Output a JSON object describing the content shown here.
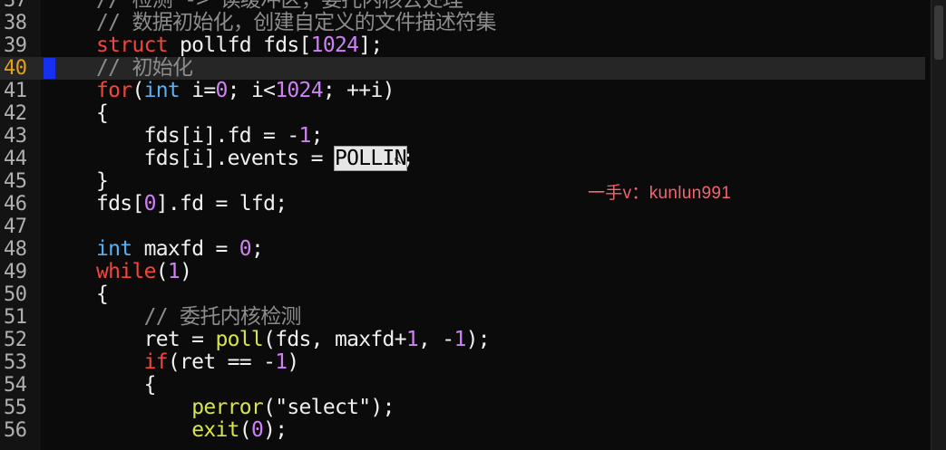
{
  "editor": {
    "current_line": "40",
    "watermark": "一手v：kunlun991",
    "colors": {
      "background": "#0b0b0b",
      "comment": "#8c8c8c",
      "keyword": "#f5453b",
      "type": "#5ab0f5",
      "number": "#d080f5",
      "function": "#d7e548",
      "current_line_number": "#e3a21a",
      "breakpoint_marker": "#1530f0"
    },
    "lines": [
      {
        "num": "37",
        "tokens": [
          {
            "text": "// 检测 -> 读缓冲区，委托内核去处理",
            "type": "comment"
          }
        ]
      },
      {
        "num": "38",
        "tokens": [
          {
            "text": "// 数据初始化，创建自定义的文件描述符集",
            "type": "comment"
          }
        ]
      },
      {
        "num": "39",
        "tokens": [
          {
            "text": "struct",
            "type": "keyword"
          },
          {
            "text": " pollfd fds[",
            "type": "plain"
          },
          {
            "text": "1024",
            "type": "number"
          },
          {
            "text": "];",
            "type": "plain"
          }
        ]
      },
      {
        "num": "40",
        "tokens": [
          {
            "text": "// 初始化",
            "type": "comment"
          }
        ]
      },
      {
        "num": "41",
        "tokens": [
          {
            "text": "for",
            "type": "keyword"
          },
          {
            "text": "(",
            "type": "plain"
          },
          {
            "text": "int",
            "type": "type"
          },
          {
            "text": " i=",
            "type": "plain"
          },
          {
            "text": "0",
            "type": "number"
          },
          {
            "text": "; i<",
            "type": "plain"
          },
          {
            "text": "1024",
            "type": "number"
          },
          {
            "text": "; ++i)",
            "type": "plain"
          }
        ]
      },
      {
        "num": "42",
        "tokens": [
          {
            "text": "{",
            "type": "plain"
          }
        ]
      },
      {
        "num": "43",
        "tokens": [
          {
            "text": "    fds[i].fd = -",
            "type": "plain"
          },
          {
            "text": "1",
            "type": "number"
          },
          {
            "text": ";",
            "type": "plain"
          }
        ]
      },
      {
        "num": "44",
        "tokens": [
          {
            "text": "    fds[i].events = ",
            "type": "plain"
          },
          {
            "text": "POLLIN",
            "type": "highlight"
          },
          {
            "text": ";",
            "type": "plain"
          }
        ]
      },
      {
        "num": "45",
        "tokens": [
          {
            "text": "}",
            "type": "plain"
          }
        ]
      },
      {
        "num": "46",
        "tokens": [
          {
            "text": "fds[",
            "type": "plain"
          },
          {
            "text": "0",
            "type": "number"
          },
          {
            "text": "].fd = lfd;",
            "type": "plain"
          }
        ]
      },
      {
        "num": "47",
        "tokens": []
      },
      {
        "num": "48",
        "tokens": [
          {
            "text": "int",
            "type": "type"
          },
          {
            "text": " maxfd = ",
            "type": "plain"
          },
          {
            "text": "0",
            "type": "number"
          },
          {
            "text": ";",
            "type": "plain"
          }
        ]
      },
      {
        "num": "49",
        "tokens": [
          {
            "text": "while",
            "type": "keyword"
          },
          {
            "text": "(",
            "type": "plain"
          },
          {
            "text": "1",
            "type": "number"
          },
          {
            "text": ")",
            "type": "plain"
          }
        ]
      },
      {
        "num": "50",
        "tokens": [
          {
            "text": "{",
            "type": "plain"
          }
        ]
      },
      {
        "num": "51",
        "tokens": [
          {
            "text": "    // 委托内核检测",
            "type": "comment"
          }
        ]
      },
      {
        "num": "52",
        "tokens": [
          {
            "text": "    ret = ",
            "type": "plain"
          },
          {
            "text": "poll",
            "type": "func"
          },
          {
            "text": "(fds, maxfd+",
            "type": "plain"
          },
          {
            "text": "1",
            "type": "number"
          },
          {
            "text": ", -",
            "type": "plain"
          },
          {
            "text": "1",
            "type": "number"
          },
          {
            "text": ");",
            "type": "plain"
          }
        ]
      },
      {
        "num": "53",
        "tokens": [
          {
            "text": "    ",
            "type": "plain"
          },
          {
            "text": "if",
            "type": "keyword"
          },
          {
            "text": "(ret == -",
            "type": "plain"
          },
          {
            "text": "1",
            "type": "number"
          },
          {
            "text": ")",
            "type": "plain"
          }
        ]
      },
      {
        "num": "54",
        "tokens": [
          {
            "text": "    {",
            "type": "plain"
          }
        ]
      },
      {
        "num": "55",
        "tokens": [
          {
            "text": "        ",
            "type": "plain"
          },
          {
            "text": "perror",
            "type": "func"
          },
          {
            "text": "(",
            "type": "plain"
          },
          {
            "text": "\"select\"",
            "type": "string"
          },
          {
            "text": ");",
            "type": "plain"
          }
        ]
      },
      {
        "num": "56",
        "tokens": [
          {
            "text": "        ",
            "type": "plain"
          },
          {
            "text": "exit",
            "type": "func"
          },
          {
            "text": "(",
            "type": "plain"
          },
          {
            "text": "0",
            "type": "number"
          },
          {
            "text": ");",
            "type": "plain"
          }
        ]
      }
    ]
  }
}
